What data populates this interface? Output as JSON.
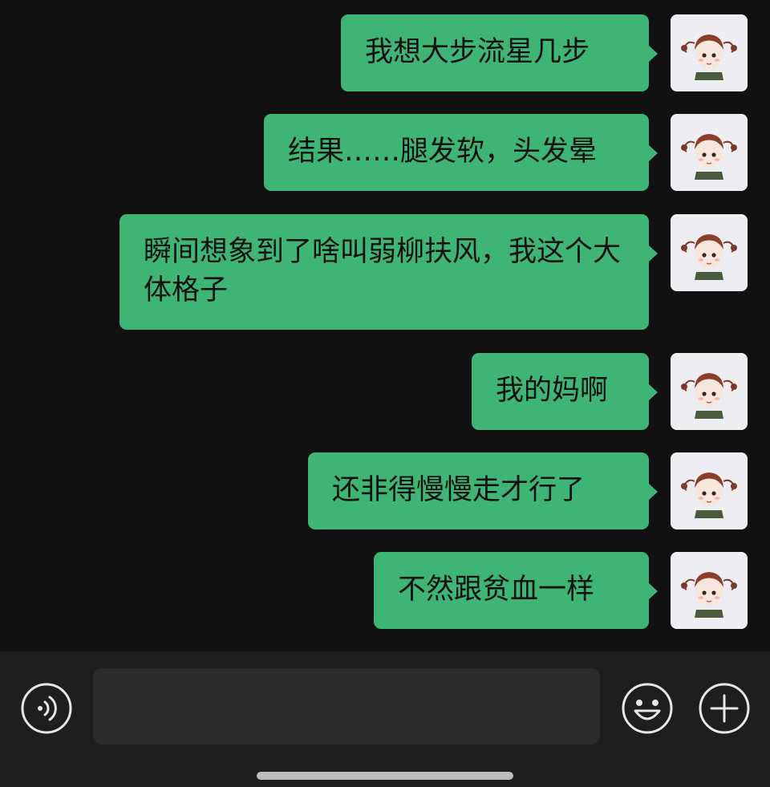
{
  "messages": [
    {
      "text": "我想大步流星几步",
      "sender": "self"
    },
    {
      "text": "结果……腿发软，头发晕",
      "sender": "self"
    },
    {
      "text": "瞬间想象到了啥叫弱柳扶风，我这个大体格子",
      "sender": "self"
    },
    {
      "text": "我的妈啊",
      "sender": "self"
    },
    {
      "text": "还非得慢慢走才行了",
      "sender": "self"
    },
    {
      "text": "不然跟贫血一样",
      "sender": "self"
    }
  ],
  "input_bar": {
    "voice_icon": "voice-icon",
    "emoji_icon": "emoji-icon",
    "plus_icon": "plus-icon",
    "input_value": ""
  },
  "colors": {
    "background": "#111111",
    "bubble_self": "#3eb575",
    "input_bar": "#1e1e1e",
    "input_field": "#2b2b2b"
  }
}
